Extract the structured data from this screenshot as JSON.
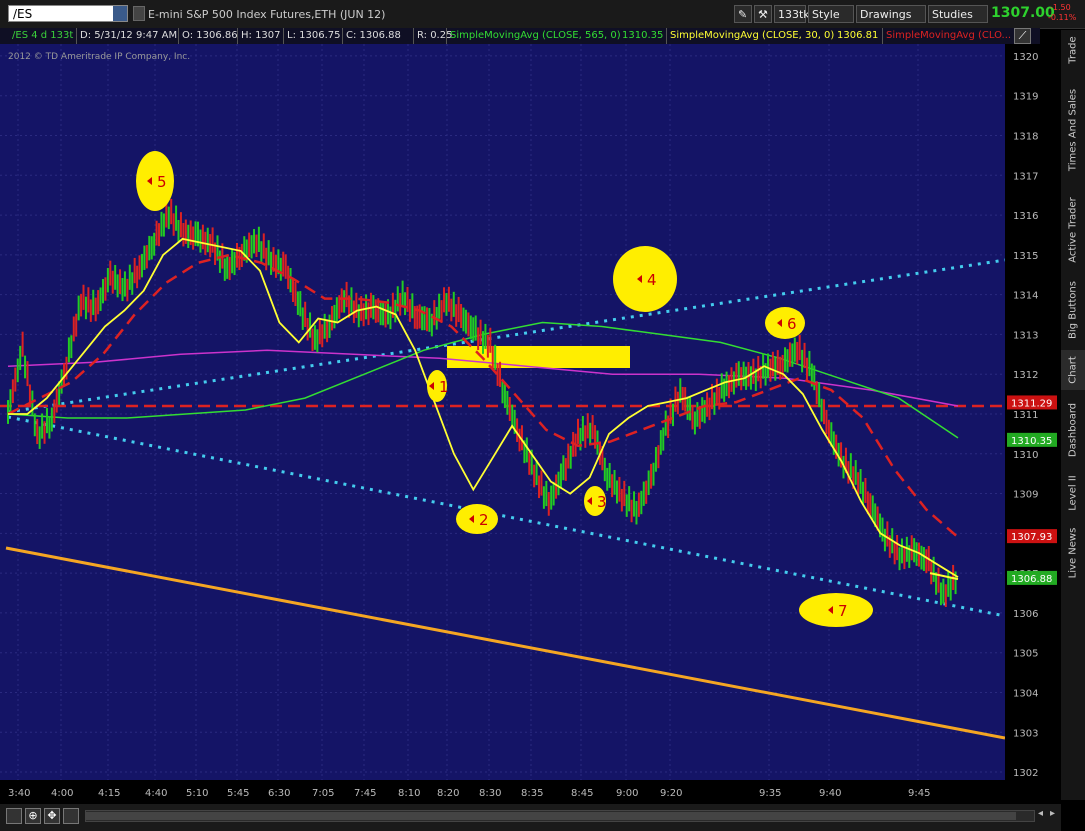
{
  "toolbar": {
    "symbol": "/ES",
    "instrument_title": "E-mini S&P 500 Index Futures,ETH (JUN 12)",
    "aggregation": "133tk",
    "style_label": "Style",
    "drawings_label": "Drawings",
    "studies_label": "Studies",
    "last_price": "1307.00",
    "change": "-1.50",
    "change_pct": "-0.11%"
  },
  "infobar": {
    "chart_id": "/ES 4 d 133t",
    "date": "D: 5/31/12 9:47 AM",
    "open": "O: 1306.86",
    "high": "H: 1307",
    "low": "L: 1306.75",
    "close": "C: 1306.88",
    "range": "R: 0.25",
    "sma1_label": "SimpleMovingAvg (CLOSE, 565, 0)",
    "sma1_value": "1310.35",
    "sma2_label": "SimpleMovingAvg (CLOSE, 30, 0)",
    "sma2_value": "1306.81",
    "sma3_label": "SimpleMovingAvg (CLO..."
  },
  "copyright": "2012 © TD Ameritrade IP Company, Inc.",
  "sidebar_tabs": [
    "Trade",
    "Times And Sales",
    "Active Trader",
    "Big Buttons",
    "Chart",
    "Dashboard",
    "Level II",
    "Live News"
  ],
  "colors": {
    "background": "#141466",
    "up_bar": "#22cc22",
    "down_bar": "#dd2222",
    "sma_fast": "#ffff33",
    "sma_mid_dashed": "#dd2222",
    "sma_green": "#33dd33",
    "sma_magenta": "#cc33cc",
    "support_dashed": "#dd2222",
    "channel_dotted": "#44ccee",
    "trend_orange": "#f5a623",
    "annotation": "#ffee00",
    "annotation_text": "#cc0000"
  },
  "chart_data": {
    "type": "line",
    "title": "/ES 4 d 133t",
    "ylim": [
      1301.8,
      1320.3
    ],
    "ytick_labels": [
      "1302",
      "1303",
      "1304",
      "1305",
      "1306",
      "1307",
      "1308",
      "1309",
      "1310",
      "1311",
      "1312",
      "1313",
      "1314",
      "1315",
      "1316",
      "1317",
      "1318",
      "1319",
      "1320"
    ],
    "xtick_labels": [
      "3:40",
      "4:00",
      "4:15",
      "4:40",
      "5:10",
      "5:45",
      "6:30",
      "7:05",
      "7:45",
      "8:10",
      "8:20",
      "8:30",
      "8:35",
      "8:45",
      "9:00",
      "9:20",
      "9:35",
      "9:40",
      "9:45"
    ],
    "price_tags": [
      {
        "label": "1311.29",
        "value": 1311.29,
        "color": "#cc1111"
      },
      {
        "label": "1310.35",
        "value": 1310.35,
        "color": "#22aa22"
      },
      {
        "label": "1307.93",
        "value": 1307.93,
        "color": "#cc1111"
      },
      {
        "label": "1306.88",
        "value": 1306.88,
        "color": "#22aa22"
      }
    ],
    "price_series": [
      1311.0,
      1312.6,
      1310.4,
      1310.8,
      1312.2,
      1313.8,
      1313.6,
      1314.4,
      1314.1,
      1314.6,
      1315.3,
      1316.0,
      1315.5,
      1315.4,
      1315.2,
      1314.6,
      1315.0,
      1315.3,
      1314.8,
      1314.6,
      1313.6,
      1312.8,
      1313.2,
      1313.9,
      1313.5,
      1313.6,
      1313.4,
      1313.9,
      1313.4,
      1313.3,
      1313.8,
      1313.4,
      1313.0,
      1312.7,
      1311.4,
      1310.4,
      1309.5,
      1308.7,
      1309.5,
      1310.4,
      1310.6,
      1309.4,
      1308.9,
      1308.5,
      1309.3,
      1310.6,
      1311.5,
      1310.8,
      1311.2,
      1311.6,
      1311.9,
      1311.9,
      1312.1,
      1312.2,
      1312.6,
      1312.0,
      1310.7,
      1309.8,
      1309.4,
      1308.7,
      1307.9,
      1307.4,
      1307.5,
      1307.2,
      1306.4,
      1306.9
    ]
  },
  "series_sma30": [
    1311.0,
    1311.0,
    1311.4,
    1312.0,
    1312.6,
    1313.2,
    1313.6,
    1314.1,
    1315.0,
    1315.4,
    1315.3,
    1315.2,
    1315.1,
    1314.6,
    1313.3,
    1312.8,
    1313.4,
    1313.3,
    1313.6,
    1313.7,
    1313.5,
    1312.6,
    1311.3,
    1310.0,
    1309.1,
    1309.9,
    1310.7,
    1310.0,
    1309.3,
    1309.0,
    1309.4,
    1310.5,
    1310.9,
    1311.2,
    1311.3,
    1311.4,
    1311.6,
    1311.8,
    1311.9,
    1312.2,
    1312.0,
    1311.5,
    1310.6,
    1309.8,
    1308.8,
    1308.0,
    1307.7,
    1307.5,
    1307.2,
    1306.9
  ],
  "series_sma_dashed": [
    1311.0,
    1311.4,
    1311.8,
    1312.5,
    1313.5,
    1314.3,
    1314.8,
    1315.0,
    1314.8,
    1314.4,
    1313.9,
    1313.9,
    1313.8,
    1313.6,
    1313.2,
    1312.4,
    1311.5,
    1310.6,
    1310.2,
    1310.3,
    1310.6,
    1310.9,
    1311.2,
    1311.3,
    1311.6,
    1311.9,
    1311.6,
    1310.9,
    1309.6,
    1308.6,
    1307.9
  ],
  "series_sma_green": [
    1311.0,
    1310.9,
    1310.9,
    1311.0,
    1311.1,
    1311.4,
    1312.0,
    1312.6,
    1313.0,
    1313.3,
    1313.2,
    1313.0,
    1312.8,
    1312.4,
    1311.9,
    1311.4,
    1310.4
  ],
  "series_sma_magenta": [
    1312.2,
    1312.3,
    1312.5,
    1312.6,
    1312.5,
    1312.4,
    1312.2,
    1312.0,
    1312.0,
    1311.9,
    1311.6,
    1311.2
  ],
  "labels": [
    {
      "text": "5"
    },
    {
      "text": "4"
    },
    {
      "text": "6"
    },
    {
      "text": "1"
    },
    {
      "text": "2"
    },
    {
      "text": "3"
    },
    {
      "text": "7"
    }
  ]
}
